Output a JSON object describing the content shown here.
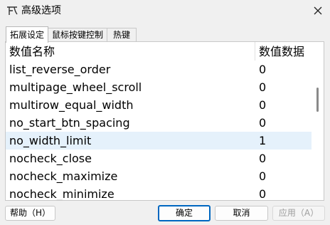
{
  "window": {
    "title": "高级选项",
    "icon": "app-icon",
    "close_icon": "close-icon"
  },
  "tabs": [
    {
      "label": "拓展设定",
      "active": true
    },
    {
      "label": "鼠标按键控制",
      "active": false
    },
    {
      "label": "热键",
      "active": false
    }
  ],
  "list": {
    "columns": {
      "name": "数值名称",
      "value": "数值数据"
    },
    "rows": [
      {
        "name": "list_reverse_order",
        "value": "0"
      },
      {
        "name": "multipage_wheel_scroll",
        "value": "0"
      },
      {
        "name": "multirow_equal_width",
        "value": "0"
      },
      {
        "name": "no_start_btn_spacing",
        "value": "0"
      },
      {
        "name": "no_width_limit",
        "value": "1",
        "selected": true
      },
      {
        "name": "nocheck_close",
        "value": "0"
      },
      {
        "name": "nocheck_maximize",
        "value": "0"
      },
      {
        "name": "nocheck_minimize",
        "value": "0"
      }
    ]
  },
  "buttons": {
    "help": "帮助（H）",
    "ok": "确定",
    "cancel": "取消",
    "apply": "应用（A）"
  },
  "colors": {
    "selection": "#e5f1fb",
    "accent": "#0067c0"
  }
}
